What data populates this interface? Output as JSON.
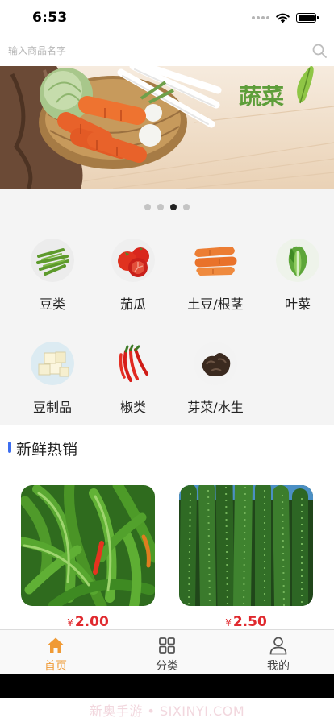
{
  "status_bar": {
    "time": "6:53"
  },
  "search": {
    "placeholder": "输入商品名字"
  },
  "banner": {
    "title": "蔬菜",
    "active_slide": 3,
    "slide_count": 4
  },
  "categories": [
    {
      "label": "豆类",
      "icon": "beans-icon"
    },
    {
      "label": "茄瓜",
      "icon": "tomato-icon"
    },
    {
      "label": "土豆/根茎",
      "icon": "carrot-icon"
    },
    {
      "label": "叶菜",
      "icon": "leafy-green-icon"
    },
    {
      "label": "豆制品",
      "icon": "tofu-icon"
    },
    {
      "label": "椒类",
      "icon": "chili-icon"
    },
    {
      "label": "芽菜/水生",
      "icon": "fungus-icon"
    }
  ],
  "section": {
    "title": "新鲜热销"
  },
  "products": [
    {
      "image": "green-chili-peppers",
      "currency": "¥",
      "price": "2.00"
    },
    {
      "image": "cucumbers",
      "currency": "¥",
      "price": "2.50"
    }
  ],
  "tabbar": {
    "active_color": "#f09a35",
    "tabs": [
      {
        "label": "首页",
        "icon": "home-icon",
        "active": true
      },
      {
        "label": "分类",
        "icon": "grid-icon",
        "active": false
      },
      {
        "label": "我的",
        "icon": "user-icon",
        "active": false
      }
    ]
  },
  "watermark": {
    "text": "新奥手游 • SIXINYI.COM"
  },
  "colors": {
    "price": "#e0292e",
    "accent": "#3d6ef0",
    "active_tab": "#f09a35"
  }
}
